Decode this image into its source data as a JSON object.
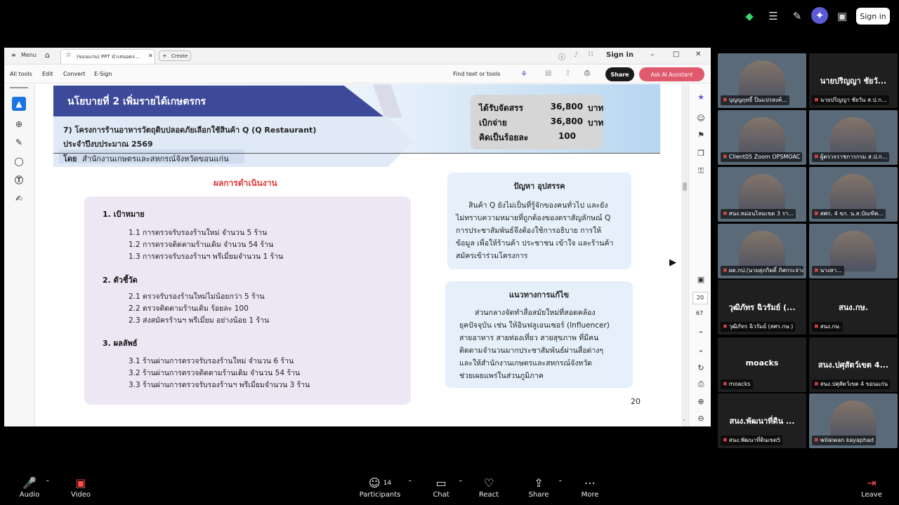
{
  "zoom_top": {
    "signin": "Sign in"
  },
  "window": {
    "menu": "Menu",
    "tab_title": "(ขอนแก่น) PPT นำเสนอตร...",
    "create": "Create",
    "signin": "Sign in",
    "toolbar": {
      "all_tools": "All tools",
      "edit": "Edit",
      "convert": "Convert",
      "esign": "E-Sign",
      "find": "Find text or tools",
      "share": "Share",
      "ask_ai": "Ask AI Assistant"
    },
    "right_page_current": "20",
    "right_page_total": "67"
  },
  "slide": {
    "title": "นโยบายที่ 2 เพิ่มรายได้เกษตรกร",
    "subtitle1": "7) โครงการร้านอาหารวัตถุดิบปลอดภัยเลือกใช้สินค้า Q (Q Restaurant)",
    "subtitle2": "ประจำปีงบประมาณ 2569",
    "org_prefix": "โดย",
    "org": "สำนักงานเกษตรและสหกรณ์จังหวัดขอนแก่น",
    "budget": [
      {
        "label": "ได้รับจัดสรร",
        "value": "36,800",
        "unit": "บาท"
      },
      {
        "label": "เบิกจ่าย",
        "value": "36,800",
        "unit": "บาท"
      },
      {
        "label": "คิดเป็นร้อยละ",
        "value": "100",
        "unit": ""
      }
    ],
    "results_title": "ผลการดำเนินงาน",
    "sections": [
      {
        "title": "1. เป้าหมาย",
        "items": [
          "1.1 การตรวจรับรองร้านใหม่ จำนวน 5 ร้าน",
          "1.2 การตรวจติดตามร้านเดิม จำนวน 54 ร้าน",
          "1.3 การตรวจรับรองร้านฯ พรีเมี่ยมจำนวน 1 ร้าน"
        ]
      },
      {
        "title": "2. ตัวชี้วัด",
        "items": [
          "2.1 ตรวจรับรองร้านใหม่ไม่น้อยกว่า 5 ร้าน",
          "2.2 ตรวจติดตามร้านเดิม ร้อยละ 100",
          "2.3 ส่งสมัครร้านฯ พรีเมี่ยม อย่างน้อย 1 ร้าน"
        ]
      },
      {
        "title": "3. ผลลัพธ์",
        "items": [
          "3.1 ร้านผ่านการตรวจรับรองร้านใหม่ จำนวน 6 ร้าน",
          "3.2 ร้านผ่านการตรวจติดตามร้านเดิม จำนวน 54 ร้าน",
          "3.3 ร้านผ่านการตรวจรับรองร้านฯ พรีเมี่ยมจำนวน 3 ร้าน"
        ]
      }
    ],
    "problem_title": "ปัญหา อุปสรรค",
    "problem_lines": [
      "สินค้า Q ยังไม่เป็นที่รู้จักของคนทั่วไป และยัง",
      "ไม่ทราบความหมายที่ถูกต้องของตราสัญลักษณ์ Q",
      "การประชาสัมพันธ์จึงต้องใช้การอธิบาย การให้",
      "ข้อมูล เพื่อให้ร้านค้า ประชาชน เข้าใจ และร้านค้า",
      "สมัครเข้าร่วมโครงการ"
    ],
    "solution_title": "แนวทางการแก้ไข",
    "solution_lines": [
      "ส่วนกลางจัดทำสื่อสมัยใหม่ที่สอดคล้อง",
      "ยุคปัจจุบัน เช่น ให้อินฟลูเอนเซอร์ (Influencer)",
      "สายอาหาร สายท่องเที่ยว  สายสุขภาพ ที่มีคน",
      "ติดตามจำนวนมากประชาสัมพันธ์ผ่านสื่อต่างๆ",
      "และให้สำนักงานเกษตรและสหกรณ์จังหวัด",
      "ช่วยเผยแพร่ในส่วนภูมิภาค"
    ],
    "page_number": "20"
  },
  "participants": [
    {
      "name": "",
      "label": "บุญญฤทธิ์ ปิ่นแปรสงค์...",
      "video": true
    },
    {
      "name": "นายปริญญา ชัยวั...",
      "label": "นายปริญญา ชัยวัน ส.ป.ก...",
      "video": false
    },
    {
      "name": "",
      "label": "Client05 Zoom OPSMOAC",
      "video": true
    },
    {
      "name": "",
      "label": "ผู้ตรวจราชการกรม ส.ป.ก...",
      "video": true
    },
    {
      "name": "",
      "label": "สนง.หม่อนไหมเขต 3 รา...",
      "video": true
    },
    {
      "name": "",
      "label": "สศก. 4 ขก. น.ส.บัณฑิต...",
      "video": true
    },
    {
      "name": "",
      "label": "ผต.กป.(นายสุภกิตติ์ ภิศกระจ่าง)",
      "video": true
    },
    {
      "name": "",
      "label": "นางสา...",
      "video": true
    },
    {
      "name": "วุฒิภัทร ฉิวรัมย์ (...",
      "label": "วุฒิภัทร ฉิวรัมย์ (สศร.กษ.)",
      "video": false
    },
    {
      "name": "สนง.กษ.",
      "label": "สนง.กษ.",
      "video": false
    },
    {
      "name": "moacks",
      "label": "moacks",
      "video": false
    },
    {
      "name": "สนง.ปศุสัตว์เขต 4...",
      "label": "สนง.ปศุสัตว์เขต 4 ขอนแก่น",
      "video": false
    },
    {
      "name": "สนง.พัฒนาที่ดิน ...",
      "label": "สนง.พัฒนาที่ดินเขต5",
      "video": false
    },
    {
      "name": "",
      "label": "wilaiwan kayaphad",
      "video": true
    }
  ],
  "bottom_bar": {
    "audio": "Audio",
    "video": "Video",
    "participants": "Participants",
    "participants_count": "14",
    "chat": "Chat",
    "react": "React",
    "share": "Share",
    "more": "More",
    "leave": "Leave"
  },
  "colors": {
    "title_band": "#3d4a9a",
    "results_title": "#e03b3b",
    "ai_button": "#e0596c",
    "results_box": "#ece7f3",
    "panel_bg": "#e6f0fa"
  }
}
